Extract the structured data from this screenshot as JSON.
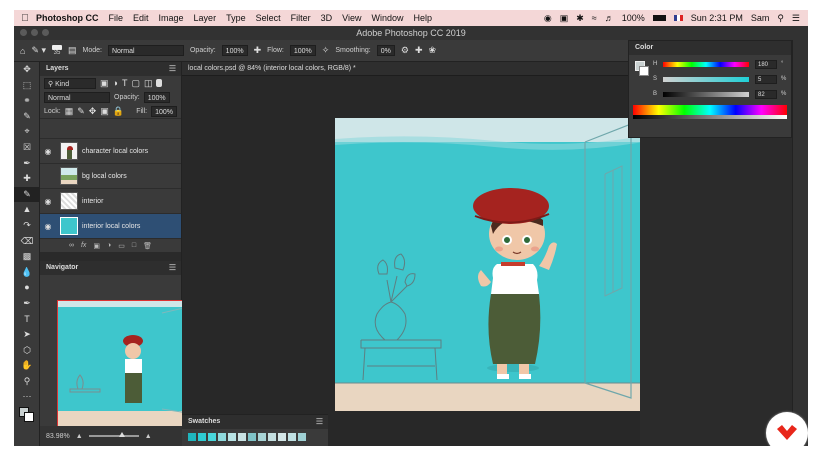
{
  "menubar": {
    "app_name": "Photoshop CC",
    "items": [
      "File",
      "Edit",
      "Image",
      "Layer",
      "Type",
      "Select",
      "Filter",
      "3D",
      "View",
      "Window",
      "Help"
    ],
    "battery": "100%",
    "clock": "Sun 2:31 PM",
    "user": "Sam"
  },
  "window": {
    "title": "Adobe Photoshop CC 2019"
  },
  "options_bar": {
    "brush_size": "35",
    "mode_label": "Mode:",
    "mode_value": "Normal",
    "opacity_label": "Opacity:",
    "opacity_value": "100%",
    "flow_label": "Flow:",
    "flow_value": "100%",
    "smoothing_label": "Smoothing:",
    "smoothing_value": "0%"
  },
  "layers_panel": {
    "tab": "Layers",
    "filter_kind": "Kind",
    "blend_mode": "Normal",
    "opacity_label": "Opacity:",
    "opacity_value": "100%",
    "lock_label": "Lock:",
    "fill_label": "Fill:",
    "fill_value": "100%",
    "layers": [
      {
        "name": "character local colors",
        "visible": true,
        "selected": false
      },
      {
        "name": "bg local colors",
        "visible": false,
        "selected": false
      },
      {
        "name": "interior",
        "visible": true,
        "selected": false
      },
      {
        "name": "interior local colors",
        "visible": true,
        "selected": true
      }
    ]
  },
  "navigator_panel": {
    "tab": "Navigator",
    "zoom": "83.98%"
  },
  "document": {
    "tab_title": "local colors.psd @ 84% (interior local colors, RGB/8) *"
  },
  "color_panel": {
    "tab": "Color",
    "h_label": "H",
    "h_value": "180",
    "h_unit": "°",
    "s_label": "S",
    "s_value": "5",
    "s_unit": "%",
    "b_label": "B",
    "b_value": "82",
    "b_unit": "%"
  },
  "swatches_panel": {
    "tab": "Swatches",
    "colors": [
      "#1fb5bd",
      "#2ecbd2",
      "#48d6db",
      "#8ed9dc",
      "#b7e2e4",
      "#c9e3e4",
      "#7fc3c7",
      "#a7d3d5",
      "#c3dedf",
      "#d3e6e7",
      "#bfe0e2",
      "#9fd1d4"
    ]
  },
  "colors": {
    "wall": "#3ec6cc",
    "floor": "#e9d6c1",
    "hat": "#a5231f",
    "pants": "#4c5c37",
    "selected_layer": "#2e4f74",
    "menubar_bg": "#f4d7d7",
    "logo_accent": "#e8261a"
  }
}
